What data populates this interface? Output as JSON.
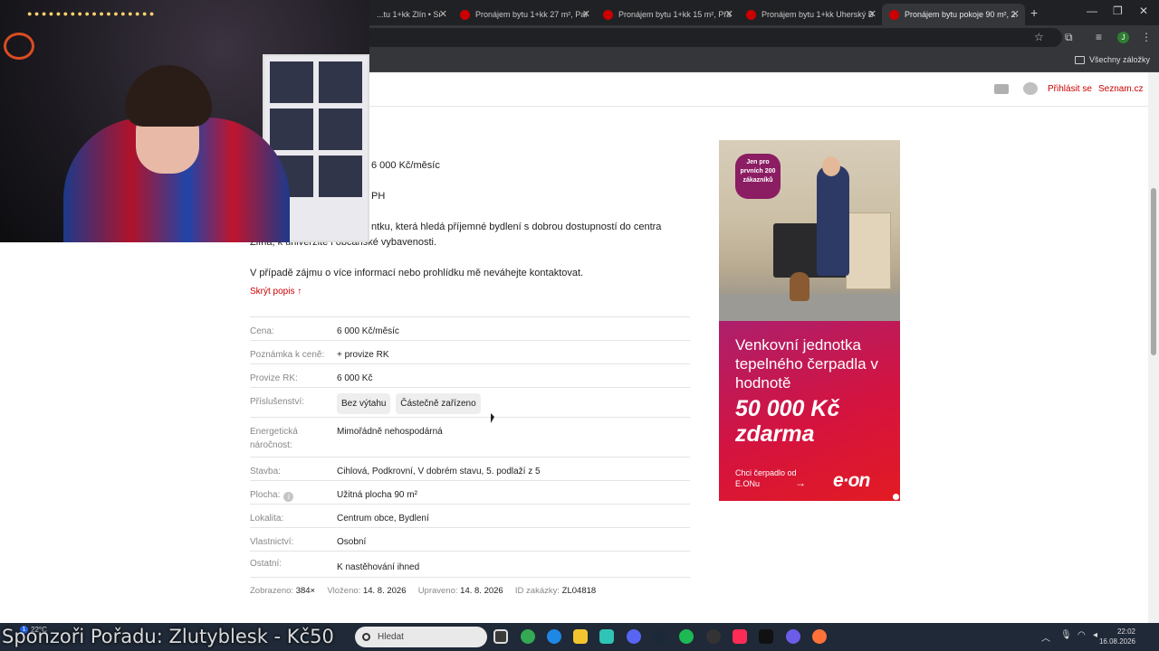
{
  "browser": {
    "tabs": [
      {
        "title": "...tu 1+kk Zlín • Srea..."
      },
      {
        "title": "Pronájem bytu 1+kk 27 m², Pal..."
      },
      {
        "title": "Pronájem bytu 1+kk 15 m², Přá..."
      },
      {
        "title": "Pronájem bytu 1+kk Uherský B..."
      },
      {
        "title": "Pronájem bytu pokoje 90 m², 2..."
      }
    ],
    "bookmarks_all": "Všechny záložky",
    "profile_initial": "J"
  },
  "site_header": {
    "login": "Přihlásit se",
    "brand": "Seznam.cz"
  },
  "listing": {
    "desc_lines": [
      "6 000 Kč/měsíc",
      "PH",
      "ntku, která hledá příjemné bydlení s dobrou dostupností do centra",
      "Zlína, k univerzitě i občanské vybavenosti.",
      "V případě zájmu o více informací nebo prohlídku mě neváhejte kontaktovat."
    ],
    "hide_desc": "Skrýt popis",
    "hide_desc_arrow": "↑",
    "params": [
      {
        "label": "Cena:",
        "value": "6 000 Kč/měsíc"
      },
      {
        "label": "Poznámka k ceně:",
        "value": "+ provize RK"
      },
      {
        "label": "Provize RK:",
        "value": "6 000 Kč"
      },
      {
        "label": "Příslušenství:",
        "chips": [
          "Bez výtahu",
          "Částečně zařízeno"
        ]
      },
      {
        "label": "Energetická náročnost:",
        "value": "Mimořádně nehospodárná"
      },
      {
        "label": "Stavba:",
        "value": "Cihlová, Podkrovní, V dobrém stavu, 5. podlaží z 5"
      },
      {
        "label": "Plocha:",
        "value": "Užitná plocha 90 m²",
        "info": "i"
      },
      {
        "label": "Lokalita:",
        "value": "Centrum obce, Bydlení"
      },
      {
        "label": "Vlastnictví:",
        "value": "Osobní"
      },
      {
        "label": "Ostatní:",
        "value": "K nastěhování ihned"
      }
    ],
    "meta": {
      "views_label": "Zobrazeno:",
      "views": "384×",
      "inserted_label": "Vloženo:",
      "inserted": "14. 8. 2026",
      "edited_label": "Upraveno:",
      "edited": "14. 8. 2026",
      "id_label": "ID zakázky:",
      "id": "ZL04818"
    }
  },
  "ad": {
    "badge": "Jen pro prvních 200 zákazníků",
    "headline": "Venkovní jednotka tepelného čerpadla v hodnotě",
    "big": "50 000 Kč zdarma",
    "cta": "Chci čerpadlo od E.ONu",
    "cta_arrow": "→",
    "logo": "e·on"
  },
  "taskbar": {
    "weather_temp": "22°C",
    "notif_count": "1",
    "search_placeholder": "Hledat",
    "time": "22:02",
    "date": "16.08.2026"
  },
  "stream_overlay": "Sponzoři Pořadu: Zlutyblesk - Kč50"
}
